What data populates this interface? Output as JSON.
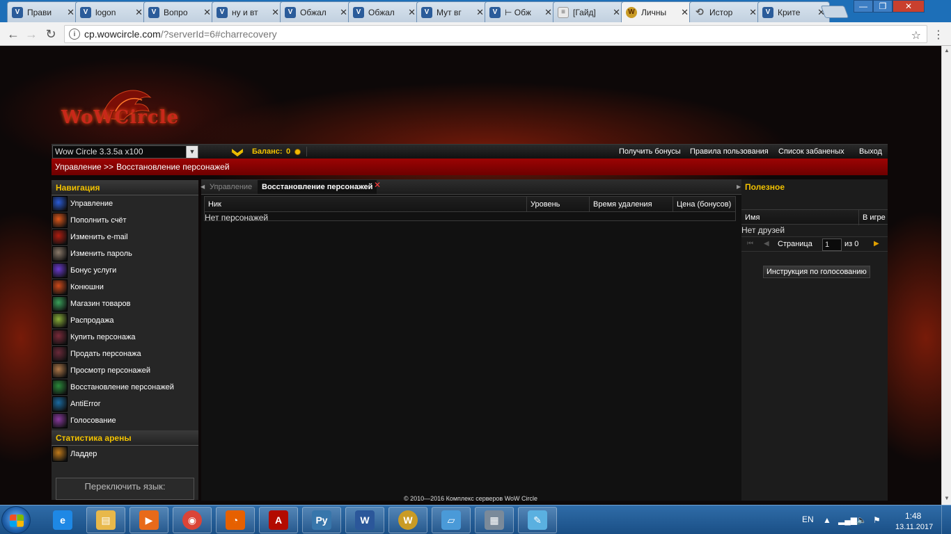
{
  "browser": {
    "tabs": [
      {
        "title": "Прави",
        "icon": "forum-favicon"
      },
      {
        "title": "logon",
        "icon": "forum-favicon"
      },
      {
        "title": "Вопро",
        "icon": "forum-favicon"
      },
      {
        "title": "ну и вт",
        "icon": "forum-favicon"
      },
      {
        "title": "Обжал",
        "icon": "forum-favicon"
      },
      {
        "title": "Обжал",
        "icon": "forum-favicon"
      },
      {
        "title": "Мут вг",
        "icon": "forum-favicon"
      },
      {
        "title": "⊢ Обж",
        "icon": "forum-favicon"
      },
      {
        "title": "[Гайд]",
        "icon": "document-favicon"
      },
      {
        "title": "Личны",
        "icon": "wow-favicon"
      },
      {
        "title": "Истор",
        "icon": "history-icon"
      },
      {
        "title": "Крите",
        "icon": "forum-favicon"
      }
    ],
    "url_host": "cp.wowcircle.com",
    "url_path": "/?serverId=6#charrecovery"
  },
  "site": {
    "server_select": "Wow Circle 3.3.5a x100",
    "balance_label": "Баланс:",
    "balance_value": "0",
    "top_links": [
      "Получить бонусы",
      "Правила пользования",
      "Список забаненых",
      "Выход"
    ],
    "breadcrumb": [
      "Управление >>",
      "Восстановление персонажей"
    ]
  },
  "sidebar": {
    "nav_title": "Навигация",
    "items": [
      {
        "label": "Управление",
        "icon": "management-icon",
        "color": "#2a5bd7"
      },
      {
        "label": "Пополнить счёт",
        "icon": "fire-icon",
        "color": "#e0581a"
      },
      {
        "label": "Изменить e-mail",
        "icon": "mail-icon",
        "color": "#b01c10"
      },
      {
        "label": "Изменить пароль",
        "icon": "password-icon",
        "color": "#8a7a6a"
      },
      {
        "label": "Бонус услуги",
        "icon": "bonus-icon",
        "color": "#6a3ad0"
      },
      {
        "label": "Конюшни",
        "icon": "stable-icon",
        "color": "#d04a1a"
      },
      {
        "label": "Магазин товаров",
        "icon": "shop-icon",
        "color": "#3aa05a"
      },
      {
        "label": "Распродажа",
        "icon": "sale-icon",
        "color": "#8ab03a"
      },
      {
        "label": "Купить персонажа",
        "icon": "buy-character-icon",
        "color": "#7a2a3a"
      },
      {
        "label": "Продать персонажа",
        "icon": "sell-character-icon",
        "color": "#6a2a3a"
      },
      {
        "label": "Просмотр персонажей",
        "icon": "view-characters-icon",
        "color": "#b07a4a"
      },
      {
        "label": "Восстановление персонажей",
        "icon": "restore-characters-icon",
        "color": "#2a8a3a"
      },
      {
        "label": "AntiError",
        "icon": "antierror-icon",
        "color": "#1a6aa0"
      },
      {
        "label": "Голосование",
        "icon": "vote-icon",
        "color": "#8a3aa0"
      }
    ],
    "arena_title": "Статистика арены",
    "arena_items": [
      {
        "label": "Ладдер",
        "icon": "ladder-icon",
        "color": "#c07a1a"
      }
    ],
    "language_label": "Переключить язык:"
  },
  "center": {
    "tabs": [
      "Управление",
      "Восстановление персонажей"
    ],
    "columns": [
      "Ник",
      "Уровень",
      "Время удаления",
      "Цена (бонусов)"
    ],
    "empty_text": "Нет персонажей"
  },
  "right_panel": {
    "title": "Полезное",
    "columns": [
      "Имя",
      "В игре"
    ],
    "empty_text": "Нет друзей",
    "page_label": "Страница",
    "page_value": "1",
    "page_of": "из 0",
    "vote_button": "Инструкция по голосованию"
  },
  "footer": "© 2010—2016 Комплекс серверов WoW Circle",
  "taskbar": {
    "apps": [
      {
        "name": "internet-explorer-icon",
        "color": "#1e88e5"
      },
      {
        "name": "file-explorer-icon",
        "color": "#e8b84a"
      },
      {
        "name": "media-player-icon",
        "color": "#e86a1a"
      },
      {
        "name": "chrome-icon",
        "color": "#db4437"
      },
      {
        "name": "firefox-icon",
        "color": "#e66000"
      },
      {
        "name": "acrobat-icon",
        "color": "#b30b00"
      },
      {
        "name": "python-icon",
        "color": "#3776ab"
      },
      {
        "name": "word-icon",
        "color": "#2b579a"
      },
      {
        "name": "wow-launcher-icon",
        "color": "#c99b25"
      },
      {
        "name": "notepad-icon",
        "color": "#4a9ad8"
      },
      {
        "name": "calculator-icon",
        "color": "#7a8a9a"
      },
      {
        "name": "paint-icon",
        "color": "#5ab0e0"
      }
    ],
    "language": "EN",
    "time": "1:48",
    "date": "13.11.2017"
  }
}
